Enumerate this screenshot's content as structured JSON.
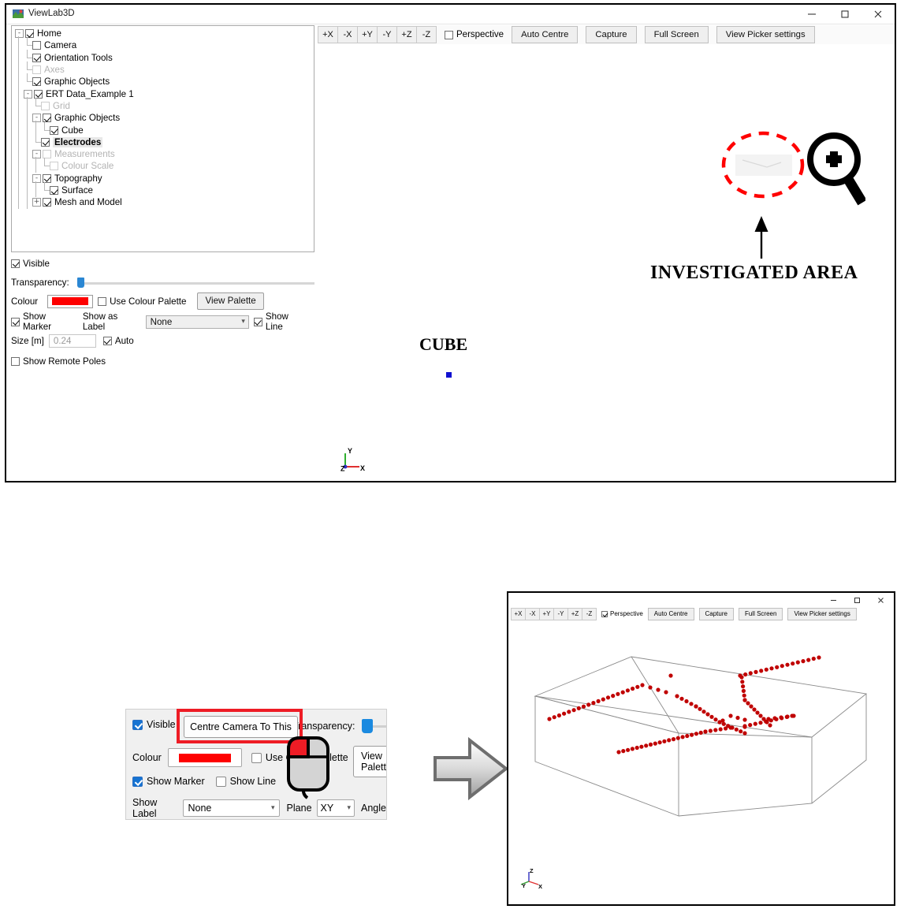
{
  "main_window": {
    "title": "ViewLab3D",
    "icon": "viewlab-icon",
    "window_controls": [
      "minimize",
      "maximize",
      "close"
    ]
  },
  "tree": {
    "items": [
      {
        "label": "Home",
        "indent": 0,
        "checked": true,
        "dim": false,
        "expander": "-",
        "selected": false
      },
      {
        "label": "Camera",
        "indent": 1,
        "checked": false,
        "dim": false,
        "expander": "",
        "selected": false
      },
      {
        "label": "Orientation Tools",
        "indent": 1,
        "checked": true,
        "dim": false,
        "expander": "",
        "selected": false
      },
      {
        "label": "Axes",
        "indent": 1,
        "checked": false,
        "dim": true,
        "expander": "",
        "selected": false
      },
      {
        "label": "Graphic Objects",
        "indent": 1,
        "checked": true,
        "dim": false,
        "expander": "",
        "selected": false
      },
      {
        "label": "ERT Data_Example 1",
        "indent": 1,
        "checked": true,
        "dim": false,
        "expander": "-",
        "selected": false
      },
      {
        "label": "Grid",
        "indent": 2,
        "checked": false,
        "dim": true,
        "expander": "",
        "selected": false
      },
      {
        "label": "Graphic Objects",
        "indent": 2,
        "checked": true,
        "dim": false,
        "expander": "-",
        "selected": false
      },
      {
        "label": "Cube",
        "indent": 3,
        "checked": true,
        "dim": false,
        "expander": "",
        "selected": false
      },
      {
        "label": "Electrodes",
        "indent": 2,
        "checked": true,
        "dim": false,
        "expander": "",
        "selected": true
      },
      {
        "label": "Measurements",
        "indent": 2,
        "checked": false,
        "dim": true,
        "expander": "-",
        "selected": false
      },
      {
        "label": "Colour Scale",
        "indent": 3,
        "checked": false,
        "dim": true,
        "expander": "",
        "selected": false
      },
      {
        "label": "Topography",
        "indent": 2,
        "checked": true,
        "dim": false,
        "expander": "-",
        "selected": false
      },
      {
        "label": "Surface",
        "indent": 3,
        "checked": true,
        "dim": false,
        "expander": "",
        "selected": false
      },
      {
        "label": "Mesh and Model",
        "indent": 2,
        "checked": true,
        "dim": false,
        "expander": "+",
        "selected": false
      }
    ]
  },
  "properties": {
    "visible_label": "Visible",
    "visible_checked": true,
    "transparency_label": "Transparency:",
    "transparency_value": 0,
    "colour_label": "Colour",
    "colour_value": "#fe0000",
    "use_palette_label": "Use Colour Palette",
    "use_palette_checked": false,
    "view_palette_label": "View Palette",
    "show_marker_label": "Show Marker",
    "show_marker_checked": true,
    "show_as_label_label": "Show as Label",
    "show_as_label_value": "None",
    "show_line_label": "Show Line",
    "show_line_checked": true,
    "size_label": "Size [m]",
    "size_value": "0.24",
    "auto_label": "Auto",
    "auto_checked": true,
    "show_remote_poles_label": "Show Remote Poles",
    "show_remote_poles_checked": false
  },
  "toolbar": {
    "axis_buttons": [
      "+X",
      "-X",
      "+Y",
      "-Y",
      "+Z",
      "-Z"
    ],
    "perspective_label": "Perspective",
    "perspective_checked": false,
    "auto_centre_label": "Auto Centre",
    "capture_label": "Capture",
    "full_screen_label": "Full Screen",
    "view_picker_label": "View Picker settings"
  },
  "viewport": {
    "cube_annotation": "CUBE",
    "investigated_area_annotation": "INVESTIGATED AREA",
    "marker_colour": "#1010d0",
    "highlight_ellipse_colour": "#ff0000",
    "magnifier_icon": "magnifier-plus-icon",
    "axes_indicator": {
      "x": "X",
      "y": "Y",
      "z": "Z",
      "x_colour": "#e03030",
      "y_colour": "#30b030",
      "z_colour": "#3030c0"
    }
  },
  "context_dialog": {
    "visible_label": "Visible",
    "visible_checked": true,
    "centre_camera_label": "Centre Camera To This",
    "highlight_colour": "#ee1c25",
    "transparency_label": "Transparency:",
    "colour_label": "Colour",
    "colour_value": "#fe0000",
    "use_palette_label": "Use Colour Palette",
    "use_palette_checked": false,
    "view_palette_label": "View Palette",
    "show_marker_label": "Show Marker",
    "show_marker_checked": true,
    "show_line_label": "Show Line",
    "show_line_checked": false,
    "show_label_label": "Show Label",
    "show_label_value": "None",
    "plane_label": "Plane",
    "plane_value": "XY",
    "angle_label": "Angle",
    "mouse_icon": "mouse-left-click-icon"
  },
  "flow_arrow": {
    "icon": "right-arrow-icon",
    "colour": "#c8c8c8"
  },
  "result_window": {
    "window_controls": [
      "minimize",
      "maximize",
      "close"
    ],
    "toolbar": {
      "axis_buttons": [
        "+X",
        "-X",
        "+Y",
        "-Y",
        "+Z",
        "-Z"
      ],
      "perspective_label": "Perspective",
      "perspective_checked": true,
      "auto_centre_label": "Auto Centre",
      "capture_label": "Capture",
      "full_screen_label": "Full Screen",
      "view_picker_label": "View Picker settings"
    },
    "scene": {
      "electrode_colour": "#c00000",
      "wireframe_colour": "#8a8a8a",
      "axes_indicator": {
        "x": "X",
        "y": "Y",
        "z": "Z"
      }
    }
  }
}
